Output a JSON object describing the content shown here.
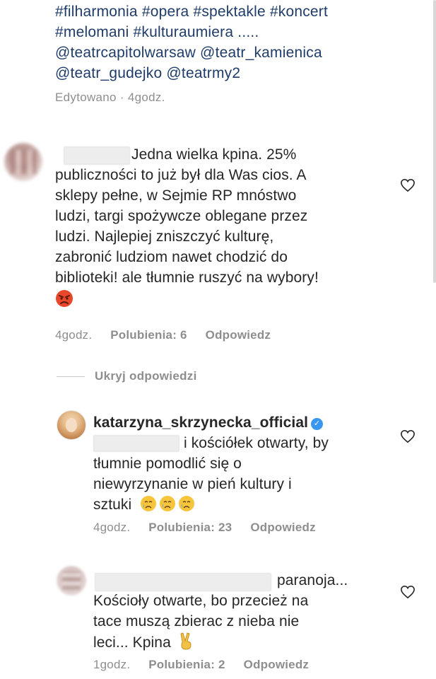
{
  "caption": {
    "lines": [
      "#filharmonia #opera #spektakle #koncert",
      "#melomani #kulturaumiera .....",
      "@teatrcapitolwarsaw @teatr_kamienica",
      "@teatr_gudejko @teatrmy2"
    ],
    "edited": "Edytowano · 4godz."
  },
  "comments": [
    {
      "lines": [
        "Jedna wielka kpina. 25%",
        "publiczności to już był dla Was cios. A",
        "sklepy pełne, w Sejmie RP mnóstwo",
        "ludzi, targi spożywcze oblegane przez",
        "ludzi. Najlepiej zniszczyć kulturę,",
        "zabronić ludziom nawet chodzić do",
        "biblioteki! ale tłumnie ruszyć na wybory!"
      ],
      "emoji": "angry-face",
      "time": "4godz.",
      "likes": "Polubienia: 6",
      "reply": "Odpowiedz"
    }
  ],
  "hide_replies": "Ukryj odpowiedzi",
  "replies": [
    {
      "username": "katarzyna_skrzynecka_official",
      "verified": true,
      "lines": [
        "i kościółek otwarty, by",
        "tłumnie pomodlić się o",
        "niewyrzynanie w pień kultury i",
        "sztuki"
      ],
      "emoji": "crying-face",
      "time": "4godz.",
      "likes": "Polubienia: 23",
      "reply": "Odpowiedz"
    },
    {
      "lines": [
        "paranoja...",
        "Kościoły otwarte, bo przecież na",
        "tace muszą  zbierac z nieba nie",
        "leci... Kpina"
      ],
      "emoji": "victory-hand",
      "time": "1godz.",
      "likes": "Polubienia: 2",
      "reply": "Odpowiedz"
    }
  ],
  "colors": {
    "hashtag": "#1f3c69",
    "meta": "#8e8e8e",
    "verified": "#3897f0",
    "text": "#262626"
  }
}
